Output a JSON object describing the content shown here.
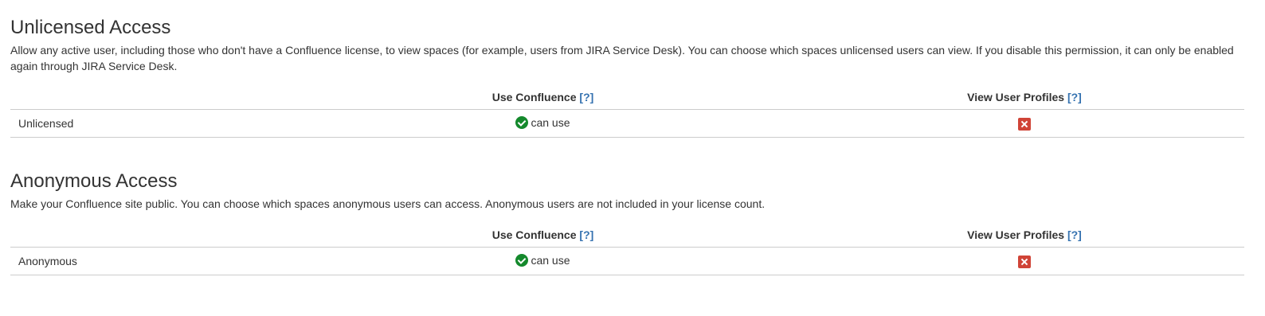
{
  "sections": [
    {
      "title": "Unlicensed Access",
      "description": "Allow any active user, including those who don't have a Confluence license, to view spaces (for example, users from JIRA Service Desk). You can choose which spaces unlicensed users can view. If you disable this permission, it can only be enabled again through JIRA Service Desk.",
      "columns": [
        {
          "label": "Use Confluence",
          "help": "[?]"
        },
        {
          "label": "View User Profiles",
          "help": "[?]"
        }
      ],
      "row": {
        "name": "Unlicensed",
        "use_confluence": {
          "status": "granted",
          "text": "can use",
          "icon": "check-circle-icon",
          "color": "#14892c"
        },
        "view_user_profiles": {
          "status": "denied",
          "icon": "cross-icon",
          "color": "#d04437"
        }
      }
    },
    {
      "title": "Anonymous Access",
      "description": "Make your Confluence site public. You can choose which spaces anonymous users can access. Anonymous users are not included in your license count.",
      "columns": [
        {
          "label": "Use Confluence",
          "help": "[?]"
        },
        {
          "label": "View User Profiles",
          "help": "[?]"
        }
      ],
      "row": {
        "name": "Anonymous",
        "use_confluence": {
          "status": "granted",
          "text": "can use",
          "icon": "check-circle-icon",
          "color": "#14892c"
        },
        "view_user_profiles": {
          "status": "denied",
          "icon": "cross-icon",
          "color": "#d04437"
        }
      }
    }
  ],
  "colors": {
    "text": "#333333",
    "link": "#3572b0",
    "border": "#cccccc"
  }
}
